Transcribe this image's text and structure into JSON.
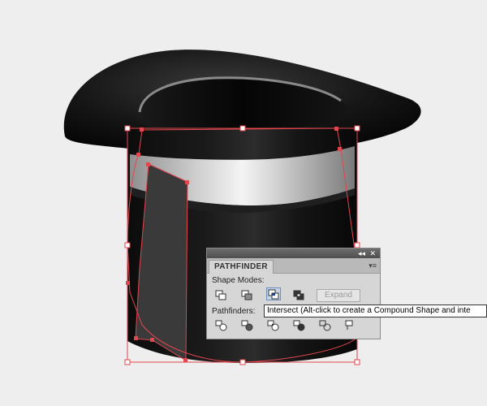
{
  "panel": {
    "title": "PATHFINDER",
    "collapse_glyph": "◂◂",
    "close_glyph": "✕",
    "menu_glyph": "▾≡",
    "shape_modes_label": "Shape Modes:",
    "pathfinders_label": "Pathfinders:",
    "expand_label": "Expand",
    "shape_mode_buttons": [
      {
        "icon": "unite-icon"
      },
      {
        "icon": "minus-front-icon"
      },
      {
        "icon": "intersect-icon",
        "active": true
      },
      {
        "icon": "exclude-icon"
      }
    ],
    "pathfinder_buttons": [
      {
        "icon": "divide-icon"
      },
      {
        "icon": "trim-icon"
      },
      {
        "icon": "merge-icon"
      },
      {
        "icon": "crop-icon"
      },
      {
        "icon": "outline-icon"
      },
      {
        "icon": "minus-back-icon"
      }
    ]
  },
  "tooltip": {
    "text": "Intersect (Alt-click to create a Compound Shape and inte"
  },
  "colors": {
    "canvas": "#eeeeee",
    "selection": "#e0474f",
    "panel_bg": "#d6d6d6",
    "hat_black": "#111111",
    "band_grey": "#d8d8d8",
    "shape_grey": "#3a3a3a"
  }
}
